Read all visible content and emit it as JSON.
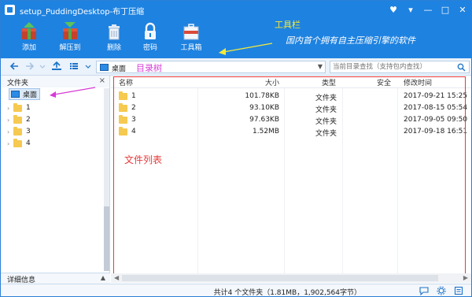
{
  "window": {
    "title": "setup_PuddingDesktop-布丁压缩",
    "controls": [
      "♥",
      "▾",
      "—",
      "□",
      "✕"
    ]
  },
  "toolbar": {
    "items": [
      {
        "label": "添加",
        "icon": "add-archive-icon"
      },
      {
        "label": "解压到",
        "icon": "extract-archive-icon"
      },
      {
        "label": "删除",
        "icon": "trash-icon"
      },
      {
        "label": "密码",
        "icon": "lock-icon"
      },
      {
        "label": "工具箱",
        "icon": "toolbox-icon"
      }
    ]
  },
  "annotations": {
    "toolbar": "工具栏",
    "toolbar_note": "国内首个拥有自主压缩引擎的软件",
    "directory_tree": "目录树",
    "file_list": "文件列表"
  },
  "navbar": {
    "address": "桌面",
    "search_placeholder": "当前目录查找（支持包内查找）"
  },
  "left_panel": {
    "header": "文件夹",
    "close": "×",
    "root": "桌面",
    "items": [
      "1",
      "2",
      "3",
      "4"
    ],
    "details_header": "详细信息",
    "details_caret": "▲"
  },
  "file_list": {
    "columns": {
      "name": "名称",
      "size": "大小",
      "type": "类型",
      "security": "安全",
      "modified": "修改时间"
    },
    "rows": [
      {
        "name": "1",
        "size": "101.78KB",
        "type": "文件夹",
        "modified": "2017-09-21 15:25"
      },
      {
        "name": "2",
        "size": "93.10KB",
        "type": "文件夹",
        "modified": "2017-08-15 05:54"
      },
      {
        "name": "3",
        "size": "97.63KB",
        "type": "文件夹",
        "modified": "2017-09-05 09:50"
      },
      {
        "name": "4",
        "size": "1.52MB",
        "type": "文件夹",
        "modified": "2017-09-18 16:51"
      }
    ]
  },
  "status": {
    "text": "共计4 个文件夹（1.81MB，1,902,564字节）"
  },
  "colors": {
    "accent": "#1e82e0",
    "annotation_yellow": "#f5ea3a",
    "annotation_magenta": "#d63bd6",
    "annotation_red": "#e53a3a"
  }
}
